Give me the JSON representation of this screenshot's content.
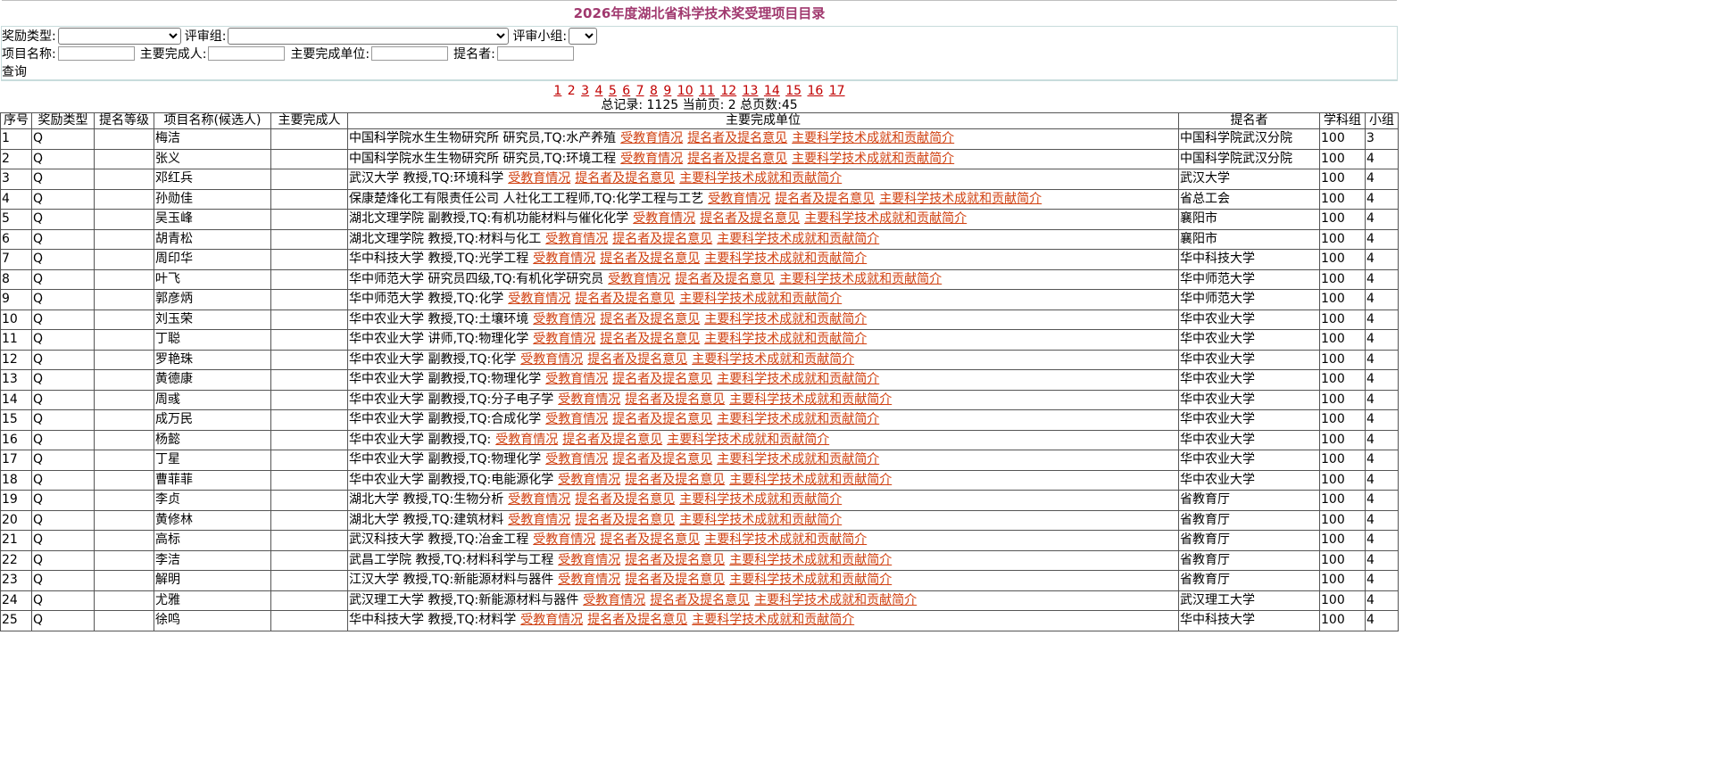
{
  "title": "2026年度湖北省科学技术奖受理项目目录",
  "filters": {
    "award_type_label": "奖励类型:",
    "review_group_label": "评审组:",
    "review_subgroup_label": "评审小组:",
    "project_name_label": "项目名称:",
    "main_person_label": "主要完成人:",
    "main_unit_label": "主要完成单位:",
    "nominator_label": "提名者:",
    "query_label": "查询"
  },
  "pager": {
    "pages": [
      "1",
      "2",
      "3",
      "4",
      "5",
      "6",
      "7",
      "8",
      "9",
      "10",
      "11",
      "12",
      "13",
      "14",
      "15",
      "16",
      "17"
    ],
    "current": "2",
    "summary": "总记录: 1125  当前页: 2 总页数:45"
  },
  "table": {
    "headers": [
      "序号",
      "奖励类型",
      "提名等级",
      "项目名称(候选人)",
      "主要完成人",
      "主要完成单位",
      "提名者",
      "学科组",
      "小组"
    ],
    "link_labels": [
      "受教育情况",
      "提名者及提名意见",
      "主要科学技术成就和贡献简介"
    ],
    "rows": [
      {
        "no": "1",
        "type": "Q",
        "level": "",
        "name": "梅洁",
        "person": "",
        "unit": "中国科学院水生生物研究所  研究员,TQ:水产养殖",
        "nominator": "中国科学院武汉分院",
        "subject": "100",
        "group": "3"
      },
      {
        "no": "2",
        "type": "Q",
        "level": "",
        "name": "张义",
        "person": "",
        "unit": "中国科学院水生生物研究所  研究员,TQ:环境工程",
        "nominator": "中国科学院武汉分院",
        "subject": "100",
        "group": "4"
      },
      {
        "no": "3",
        "type": "Q",
        "level": "",
        "name": "邓红兵",
        "person": "",
        "unit": "武汉大学  教授,TQ:环境科学",
        "nominator": "武汉大学",
        "subject": "100",
        "group": "4"
      },
      {
        "no": "4",
        "type": "Q",
        "level": "",
        "name": "孙勋佳",
        "person": "",
        "unit": "保康楚烽化工有限责任公司  人社化工工程师,TQ:化学工程与工艺",
        "nominator": "省总工会",
        "subject": "100",
        "group": "4"
      },
      {
        "no": "5",
        "type": "Q",
        "level": "",
        "name": "吴玉峰",
        "person": "",
        "unit": "湖北文理学院  副教授,TQ:有机功能材料与催化化学",
        "nominator": "襄阳市",
        "subject": "100",
        "group": "4"
      },
      {
        "no": "6",
        "type": "Q",
        "level": "",
        "name": "胡青松",
        "person": "",
        "unit": "湖北文理学院  教授,TQ:材料与化工",
        "nominator": "襄阳市",
        "subject": "100",
        "group": "4"
      },
      {
        "no": "7",
        "type": "Q",
        "level": "",
        "name": "周印华",
        "person": "",
        "unit": "华中科技大学  教授,TQ:光学工程",
        "nominator": "华中科技大学",
        "subject": "100",
        "group": "4"
      },
      {
        "no": "8",
        "type": "Q",
        "level": "",
        "name": "叶飞",
        "person": "",
        "unit": "华中师范大学  研究员四级,TQ:有机化学研究员",
        "nominator": "华中师范大学",
        "subject": "100",
        "group": "4"
      },
      {
        "no": "9",
        "type": "Q",
        "level": "",
        "name": "郭彦炳",
        "person": "",
        "unit": "华中师范大学  教授,TQ:化学",
        "nominator": "华中师范大学",
        "subject": "100",
        "group": "4"
      },
      {
        "no": "10",
        "type": "Q",
        "level": "",
        "name": "刘玉荣",
        "person": "",
        "unit": "华中农业大学  教授,TQ:土壤环境",
        "nominator": "华中农业大学",
        "subject": "100",
        "group": "4"
      },
      {
        "no": "11",
        "type": "Q",
        "level": "",
        "name": "丁聪",
        "person": "",
        "unit": "华中农业大学  讲师,TQ:物理化学",
        "nominator": "华中农业大学",
        "subject": "100",
        "group": "4"
      },
      {
        "no": "12",
        "type": "Q",
        "level": "",
        "name": "罗艳珠",
        "person": "",
        "unit": "华中农业大学  副教授,TQ:化学",
        "nominator": "华中农业大学",
        "subject": "100",
        "group": "4"
      },
      {
        "no": "13",
        "type": "Q",
        "level": "",
        "name": "黄德康",
        "person": "",
        "unit": "华中农业大学  副教授,TQ:物理化学",
        "nominator": "华中农业大学",
        "subject": "100",
        "group": "4"
      },
      {
        "no": "14",
        "type": "Q",
        "level": "",
        "name": "周彧",
        "person": "",
        "unit": "华中农业大学  副教授,TQ:分子电子学",
        "nominator": "华中农业大学",
        "subject": "100",
        "group": "4"
      },
      {
        "no": "15",
        "type": "Q",
        "level": "",
        "name": "成万民",
        "person": "",
        "unit": "华中农业大学  副教授,TQ:合成化学",
        "nominator": "华中农业大学",
        "subject": "100",
        "group": "4"
      },
      {
        "no": "16",
        "type": "Q",
        "level": "",
        "name": "杨懿",
        "person": "",
        "unit": "华中农业大学  副教授,TQ:",
        "nominator": "华中农业大学",
        "subject": "100",
        "group": "4"
      },
      {
        "no": "17",
        "type": "Q",
        "level": "",
        "name": "丁星",
        "person": "",
        "unit": "华中农业大学  副教授,TQ:物理化学",
        "nominator": "华中农业大学",
        "subject": "100",
        "group": "4"
      },
      {
        "no": "18",
        "type": "Q",
        "level": "",
        "name": "曹菲菲",
        "person": "",
        "unit": "华中农业大学  副教授,TQ:电能源化学",
        "nominator": "华中农业大学",
        "subject": "100",
        "group": "4"
      },
      {
        "no": "19",
        "type": "Q",
        "level": "",
        "name": "李贞",
        "person": "",
        "unit": "湖北大学  教授,TQ:生物分析",
        "nominator": "省教育厅",
        "subject": "100",
        "group": "4"
      },
      {
        "no": "20",
        "type": "Q",
        "level": "",
        "name": "黄修林",
        "person": "",
        "unit": "湖北大学  教授,TQ:建筑材料",
        "nominator": "省教育厅",
        "subject": "100",
        "group": "4"
      },
      {
        "no": "21",
        "type": "Q",
        "level": "",
        "name": "高标",
        "person": "",
        "unit": "武汉科技大学  教授,TQ:冶金工程",
        "nominator": "省教育厅",
        "subject": "100",
        "group": "4"
      },
      {
        "no": "22",
        "type": "Q",
        "level": "",
        "name": "李洁",
        "person": "",
        "unit": "武昌工学院  教授,TQ:材料科学与工程",
        "nominator": "省教育厅",
        "subject": "100",
        "group": "4"
      },
      {
        "no": "23",
        "type": "Q",
        "level": "",
        "name": "解明",
        "person": "",
        "unit": "江汉大学  教授,TQ:新能源材料与器件",
        "nominator": "省教育厅",
        "subject": "100",
        "group": "4"
      },
      {
        "no": "24",
        "type": "Q",
        "level": "",
        "name": "尤雅",
        "person": "",
        "unit": "武汉理工大学  教授,TQ:新能源材料与器件",
        "nominator": "武汉理工大学",
        "subject": "100",
        "group": "4"
      },
      {
        "no": "25",
        "type": "Q",
        "level": "",
        "name": "徐鸣",
        "person": "",
        "unit": "华中科技大学  教授,TQ:材料学",
        "nominator": "华中科技大学",
        "subject": "100",
        "group": "4"
      }
    ]
  },
  "colors": {
    "title": "#a0386e",
    "link": "#d04010",
    "pager": "#c00000"
  }
}
